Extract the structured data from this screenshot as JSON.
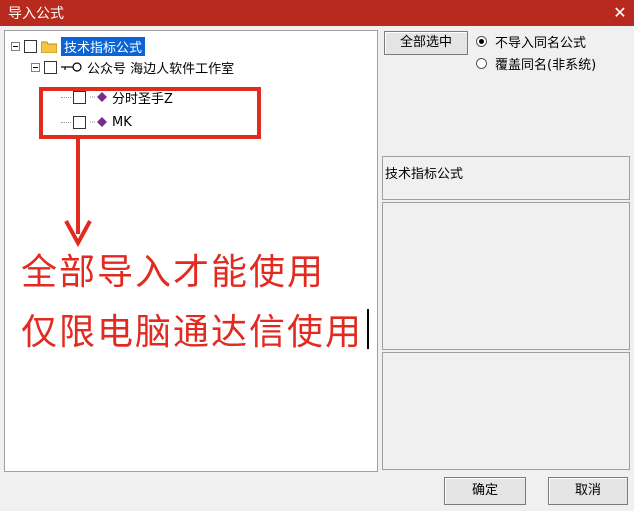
{
  "window": {
    "title": "导入公式",
    "close_glyph": "✕"
  },
  "tree": {
    "root": {
      "label": "技术指标公式",
      "icon": "folder-icon"
    },
    "group": {
      "label": "公众号 海边人软件工作室",
      "icon": "key-icon"
    },
    "items": [
      {
        "label": "分时圣手Z",
        "icon": "formula-icon"
      },
      {
        "label": "MK",
        "icon": "formula-icon"
      }
    ]
  },
  "actions": {
    "select_all": "全部选中",
    "ok": "确定",
    "cancel": "取消"
  },
  "options": {
    "selected": "不导入同名公式",
    "choices": [
      "不导入同名公式",
      "覆盖同名(非系统)"
    ]
  },
  "info": {
    "category_label": "技术指标公式"
  },
  "annotations": {
    "line1": "全部导入才能使用",
    "line2": "仅限电脑通达信使用"
  },
  "colors": {
    "title_bar": "#b82a1e",
    "annotation_red": "#e12a20",
    "selection": "#0a64d6"
  }
}
